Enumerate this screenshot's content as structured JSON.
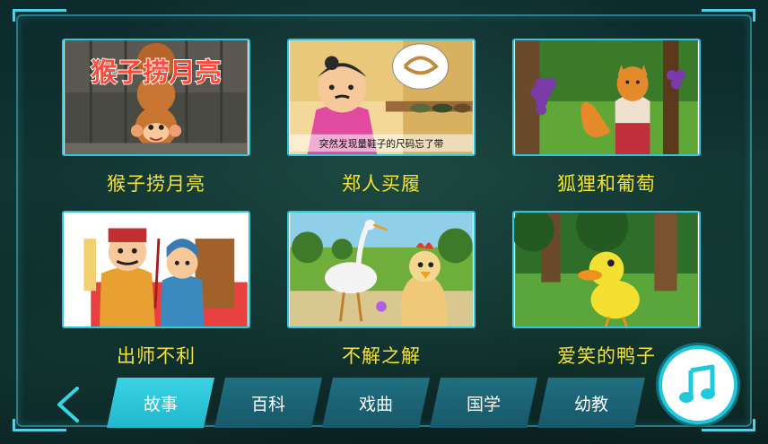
{
  "stories": [
    {
      "title": "猴子捞月亮",
      "thumb_text": "猴子捞月亮"
    },
    {
      "title": "郑人买履",
      "thumb_caption": "突然发现量鞋子的尺码忘了带"
    },
    {
      "title": "狐狸和葡萄"
    },
    {
      "title": "出师不利"
    },
    {
      "title": "不解之解"
    },
    {
      "title": "爱笑的鸭子"
    }
  ],
  "tabs": [
    {
      "label": "故事",
      "active": true
    },
    {
      "label": "百科",
      "active": false
    },
    {
      "label": "戏曲",
      "active": false
    },
    {
      "label": "国学",
      "active": false
    },
    {
      "label": "幼教",
      "active": false
    }
  ],
  "icons": {
    "back": "chevron-left-icon",
    "music": "music-note-icon"
  },
  "colors": {
    "accent": "#31c6d9",
    "title": "#f4e135",
    "tab": "#1f6f80",
    "tab_active": "#2cc4d8"
  }
}
